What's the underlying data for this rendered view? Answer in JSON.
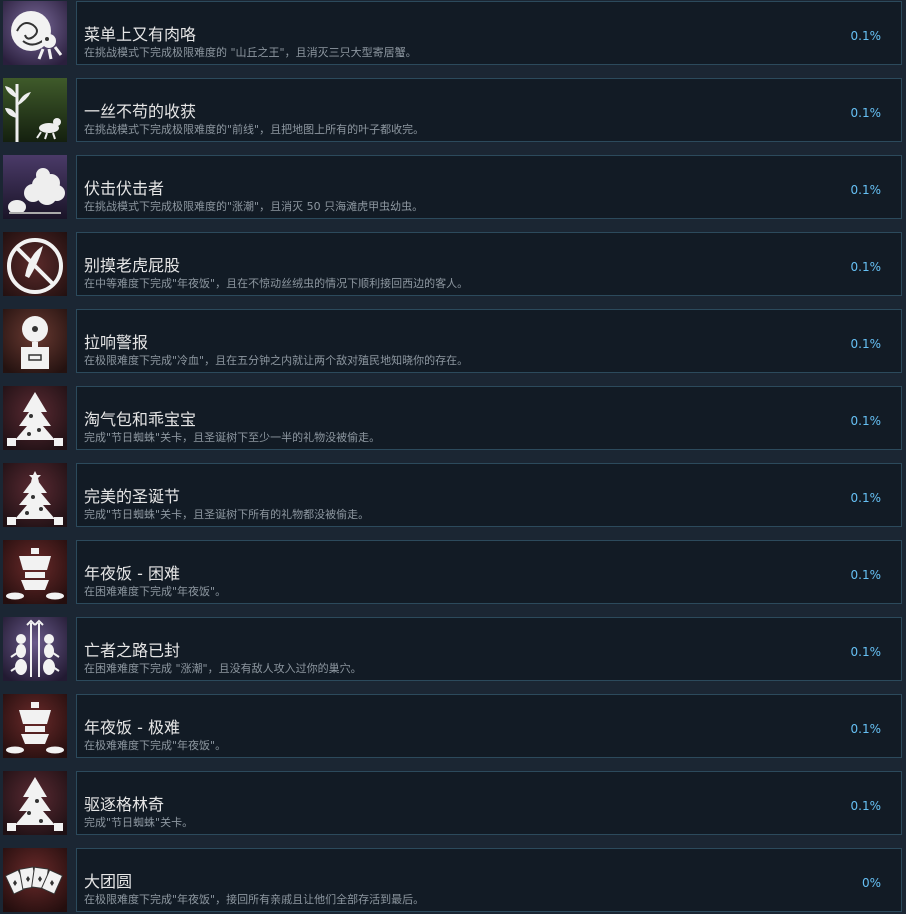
{
  "achievements": [
    {
      "icon": "hermit-crab-icon",
      "title": "菜单上又有肉咯",
      "desc": "在挑战模式下完成极限难度的 \"山丘之王\"，且消灭三只大型寄居蟹。",
      "pct": "0.1%"
    },
    {
      "icon": "leaf-harvest-icon",
      "title": "一丝不苟的收获",
      "desc": "在挑战模式下完成极限难度的\"前线\"，且把地图上所有的叶子都收完。",
      "pct": "0.1%"
    },
    {
      "icon": "beetle-ambush-icon",
      "title": "伏击伏击者",
      "desc": "在挑战模式下完成极限难度的\"涨潮\"，且消灭 50 只海滩虎甲虫幼虫。",
      "pct": "0.1%"
    },
    {
      "icon": "no-feather-icon",
      "title": "别摸老虎屁股",
      "desc": "在中等难度下完成\"年夜饭\"，且在不惊动丝绒虫的情况下顺利接回西边的客人。",
      "pct": "0.1%"
    },
    {
      "icon": "alarm-bell-icon",
      "title": "拉响警报",
      "desc": "在极限难度下完成\"冷血\"，且在五分钟之内就让两个敌对殖民地知晓你的存在。",
      "pct": "0.1%"
    },
    {
      "icon": "christmas-tree-icon",
      "title": "淘气包和乖宝宝",
      "desc": "完成\"节日蜘蛛\"关卡，且圣诞树下至少一半的礼物没被偷走。",
      "pct": "0.1%"
    },
    {
      "icon": "christmas-tree-icon",
      "title": "完美的圣诞节",
      "desc": "完成\"节日蜘蛛\"关卡，且圣诞树下所有的礼物都没被偷走。",
      "pct": "0.1%"
    },
    {
      "icon": "dinner-pot-icon",
      "title": "年夜饭 - 困难",
      "desc": "在困难难度下完成\"年夜饭\"。",
      "pct": "0.1%"
    },
    {
      "icon": "ant-guards-icon",
      "title": "亡者之路已封",
      "desc": "在困难难度下完成 \"涨潮\"，且没有敌人攻入过你的巢穴。",
      "pct": "0.1%"
    },
    {
      "icon": "dinner-pot-icon",
      "title": "年夜饭 - 极难",
      "desc": "在极难难度下完成\"年夜饭\"。",
      "pct": "0.1%"
    },
    {
      "icon": "christmas-tree-icon",
      "title": "驱逐格林奇",
      "desc": "完成\"节日蜘蛛\"关卡。",
      "pct": "0.1%"
    },
    {
      "icon": "playing-cards-icon",
      "title": "大团圆",
      "desc": "在极限难度下完成\"年夜饭\"，接回所有亲戚且让他们全部存活到最后。",
      "pct": "0%"
    }
  ],
  "colors": {
    "panel": "#121b25",
    "border": "#2c4a5c",
    "title": "#e6e6e6",
    "desc": "#8d97a0",
    "percent": "#66c0f4"
  }
}
